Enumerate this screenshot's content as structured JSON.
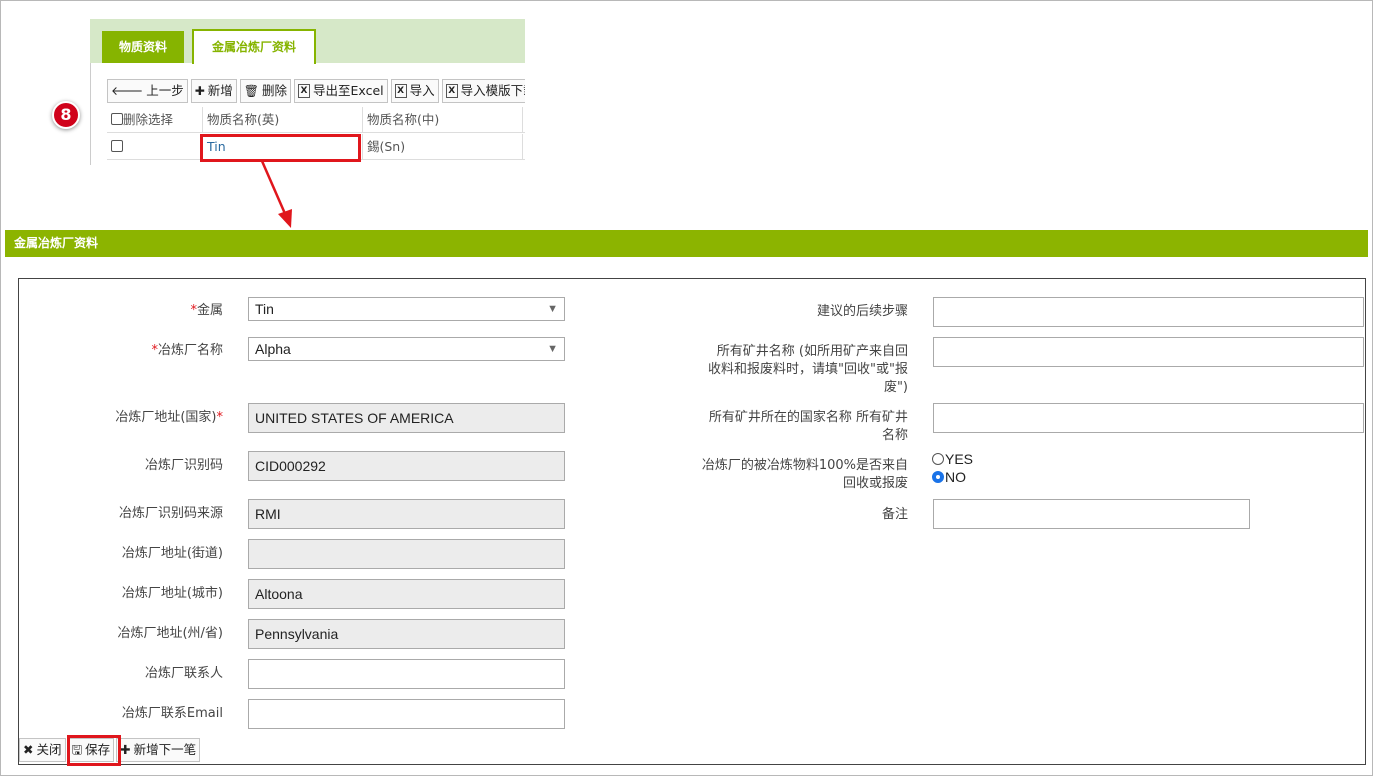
{
  "tabs": [
    {
      "label": "物质资料"
    },
    {
      "label": "金属冶炼厂资料"
    }
  ],
  "toolbar": {
    "prev_label": "上一步",
    "add_label": "新增",
    "delete_label": "删除",
    "export_label": "导出至Excel",
    "import_label": "导入",
    "import_template_label": "导入模版下载"
  },
  "grid": {
    "headers": [
      "删除选择",
      "物质名称(英)",
      "物质名称(中)"
    ],
    "rows": [
      {
        "name_en": "Tin",
        "name_zh": "錫(Sn)"
      }
    ]
  },
  "step_badge": "8",
  "section_title": "金属冶炼厂资料",
  "form": {
    "metal": {
      "label": "金属",
      "value": "Tin"
    },
    "smelter_name": {
      "label": "冶炼厂名称",
      "value": "Alpha"
    },
    "country": {
      "label": "冶炼厂地址(国家)",
      "value": "UNITED STATES OF AMERICA"
    },
    "smelter_id": {
      "label": "冶炼厂识别码",
      "value": "CID000292"
    },
    "id_source": {
      "label": "冶炼厂识别码来源",
      "value": "RMI"
    },
    "street": {
      "label": "冶炼厂地址(街道)",
      "value": ""
    },
    "city": {
      "label": "冶炼厂地址(城市)",
      "value": "Altoona"
    },
    "state": {
      "label": "冶炼厂地址(州/省)",
      "value": "Pennsylvania"
    },
    "contact": {
      "label": "冶炼厂联系人",
      "value": ""
    },
    "contact_email": {
      "label": "冶炼厂联系Email",
      "value": ""
    },
    "next_steps": {
      "label": "建议的后续步骤",
      "value": ""
    },
    "mine_name": {
      "label_1": "所有矿井名称 (如所用矿产来自回",
      "label_2": "收料和报废料时，请填\"回收\"或\"报",
      "label_3": "废\")",
      "value": ""
    },
    "mine_country": {
      "label_1": "所有矿井所在的国家名称 所有矿井",
      "label_2": "名称",
      "value": ""
    },
    "recycled": {
      "label_1": "冶炼厂的被冶炼物料100%是否来自",
      "label_2": "回收或报废",
      "option_yes": "YES",
      "option_no": "NO",
      "selected": "NO"
    },
    "remarks": {
      "label": "备注",
      "value": ""
    }
  },
  "buttons": {
    "close_label": "关闭",
    "save_label": "保存",
    "add_next_label": "新增下一笔"
  },
  "colors": {
    "accent_green": "#8cb400",
    "highlight_red": "#e0161c",
    "tab_bg": "#d6e8c8"
  }
}
